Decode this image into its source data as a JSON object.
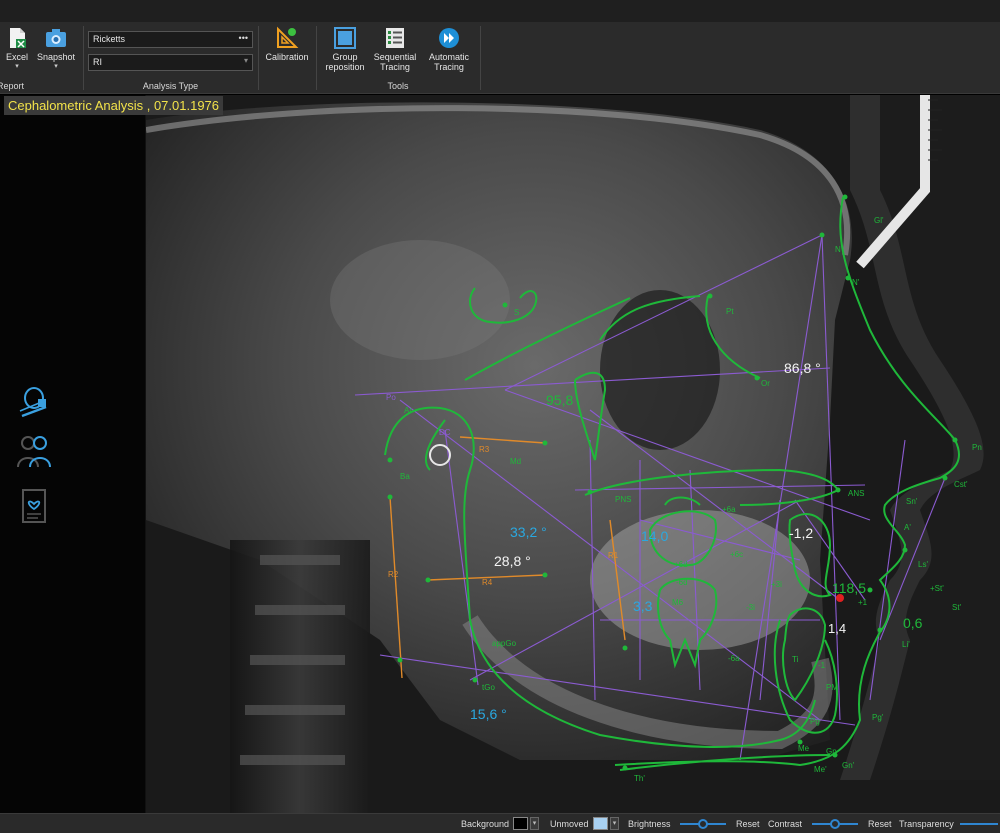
{
  "ribbon": {
    "report": {
      "group_label": "Report",
      "excel_label": "Excel",
      "snapshot_label": "Snapshot"
    },
    "analysis_type": {
      "group_label": "Analysis Type",
      "analysis_value": "Ricketts",
      "subtype_value": "RI"
    },
    "calibration_label": "Calibration",
    "tools": {
      "group_label": "Tools",
      "group_reposition_label": "Group\nreposition",
      "sequential_tracing_label": "Sequential\nTracing",
      "automatic_tracing_label": "Automatic\nTracing"
    }
  },
  "study": {
    "title": "Cephalometric Analysis  , 07.01.1976"
  },
  "measurements": {
    "m1": "86,8 °",
    "m2": "95,8",
    "m3": "33,2 °",
    "m4": "28,8 °",
    "m5": "14,0",
    "m6": "-1,2",
    "m7": "3,3",
    "m8": "118,5",
    "m9": "1,4",
    "m10": "0,6",
    "m11": "15,6 °"
  },
  "landmarks": {
    "gl": "Gl'",
    "n": "N",
    "n_soft": "N'",
    "s": "S",
    "or": "Or",
    "pn": "Pn",
    "cst": "Cst'",
    "sn": "Sn'",
    "ans": "ANS",
    "pns": "PNS",
    "a": "A'",
    "ls": "Ls'",
    "st": "St'",
    "st_plus": "+St'",
    "li": "Li'",
    "ba": "Ba",
    "po": "Po",
    "pt": "Pt",
    "dc": "DC",
    "r3": "R3",
    "md": "Md",
    "r4": "R4",
    "r1": "R1",
    "r2": "R2",
    "app_go": "appGo",
    "tgo": "tGo",
    "pm": "PM",
    "pg": "Pg",
    "pg_soft": "Pg'",
    "me": "Me",
    "me_soft": "Me'",
    "gn": "Gn",
    "gn_soft": "Gn'",
    "th": "Th'",
    "u6a": "+6a",
    "u6c": "+6c",
    "u6d": "+6d",
    "l6a": "-6a",
    "l6d": "-6d",
    "m6": "M6",
    "u3i": "+3i",
    "l3i": "-3i",
    "u1": "+1",
    "l1": "-1",
    "ti": "Ti",
    "ar": "Ar",
    "ppt": "Pt"
  },
  "statusbar": {
    "background_label": "Background",
    "unmoved_label": "Unmoved",
    "brightness_label": "Brightness",
    "reset1_label": "Reset",
    "contrast_label": "Contrast",
    "reset2_label": "Reset",
    "transparency_label": "Transparency"
  },
  "colors": {
    "tracing": "#1fb83a",
    "construct": "#8b5bd1",
    "orange": "#e08a2a",
    "cyan_value": "#2aa8e0",
    "title_text": "#f2e24a"
  }
}
